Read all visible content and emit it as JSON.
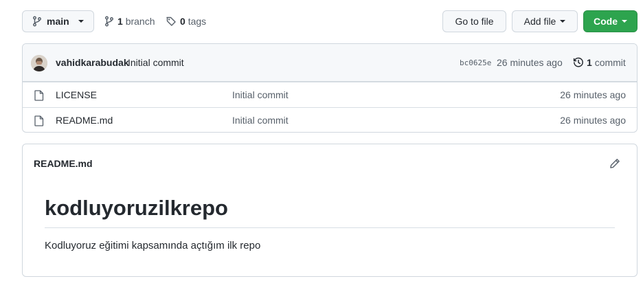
{
  "topbar": {
    "branch_label": "main",
    "branches_count": "1",
    "branches_label": "branch",
    "tags_count": "0",
    "tags_label": "tags",
    "goto_file_label": "Go to file",
    "add_file_label": "Add file",
    "code_label": "Code"
  },
  "latest_commit": {
    "author": "vahidkarabudak",
    "message": "Initial commit",
    "sha": "bc0625e",
    "time": "26 minutes ago",
    "commits_count": "1",
    "commits_label": "commit"
  },
  "files": [
    {
      "name": "LICENSE",
      "message": "Initial commit",
      "age": "26 minutes ago",
      "icon": "file-icon"
    },
    {
      "name": "README.md",
      "message": "Initial commit",
      "age": "26 minutes ago",
      "icon": "file-icon"
    }
  ],
  "readme": {
    "file_title": "README.md",
    "heading": "kodluyoruzilkrepo",
    "body": "Kodluyoruz eğitimi kapsamında açtığım ilk repo"
  },
  "colors": {
    "primary_button": "#2da44e",
    "border": "#d0d7de",
    "muted_text": "#57606a"
  }
}
